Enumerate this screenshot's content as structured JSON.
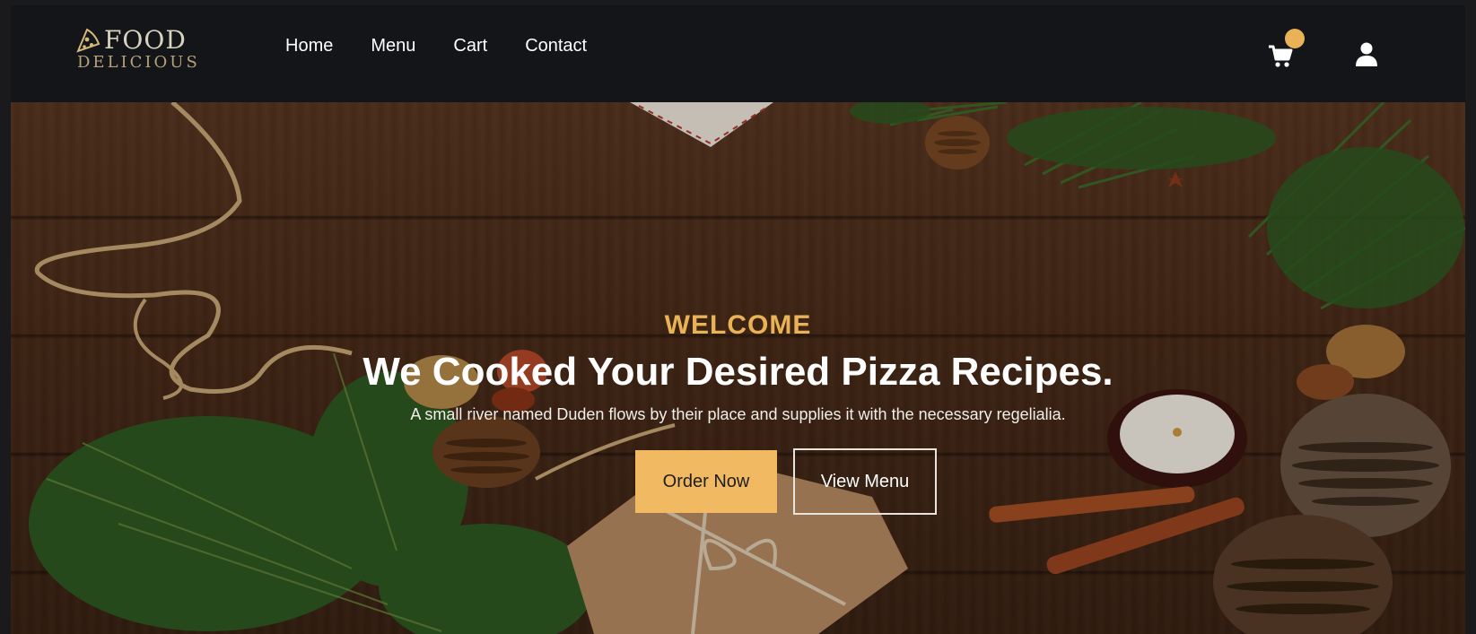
{
  "brand": {
    "name_top": "FOOD",
    "name_bottom": "DELICIOUS",
    "icon": "pizza-slice-icon",
    "accent_color": "#e9b257"
  },
  "nav": {
    "items": [
      {
        "label": "Home"
      },
      {
        "label": "Menu"
      },
      {
        "label": "Cart"
      },
      {
        "label": "Contact"
      }
    ],
    "cart_icon": "cart-icon",
    "user_icon": "user-icon"
  },
  "hero": {
    "eyebrow": "WELCOME",
    "title": "We Cooked Your Desired Pizza Recipes.",
    "subtitle": "A small river named Duden flows by their place and supplies it with the necessary regelialia.",
    "primary_button": "Order Now",
    "secondary_button": "View Menu",
    "background": "wooden-table-christmas-decor-photo"
  },
  "colors": {
    "navbar_bg": "#131518",
    "button_primary": "#f1b961",
    "text_light": "#ffffff"
  }
}
